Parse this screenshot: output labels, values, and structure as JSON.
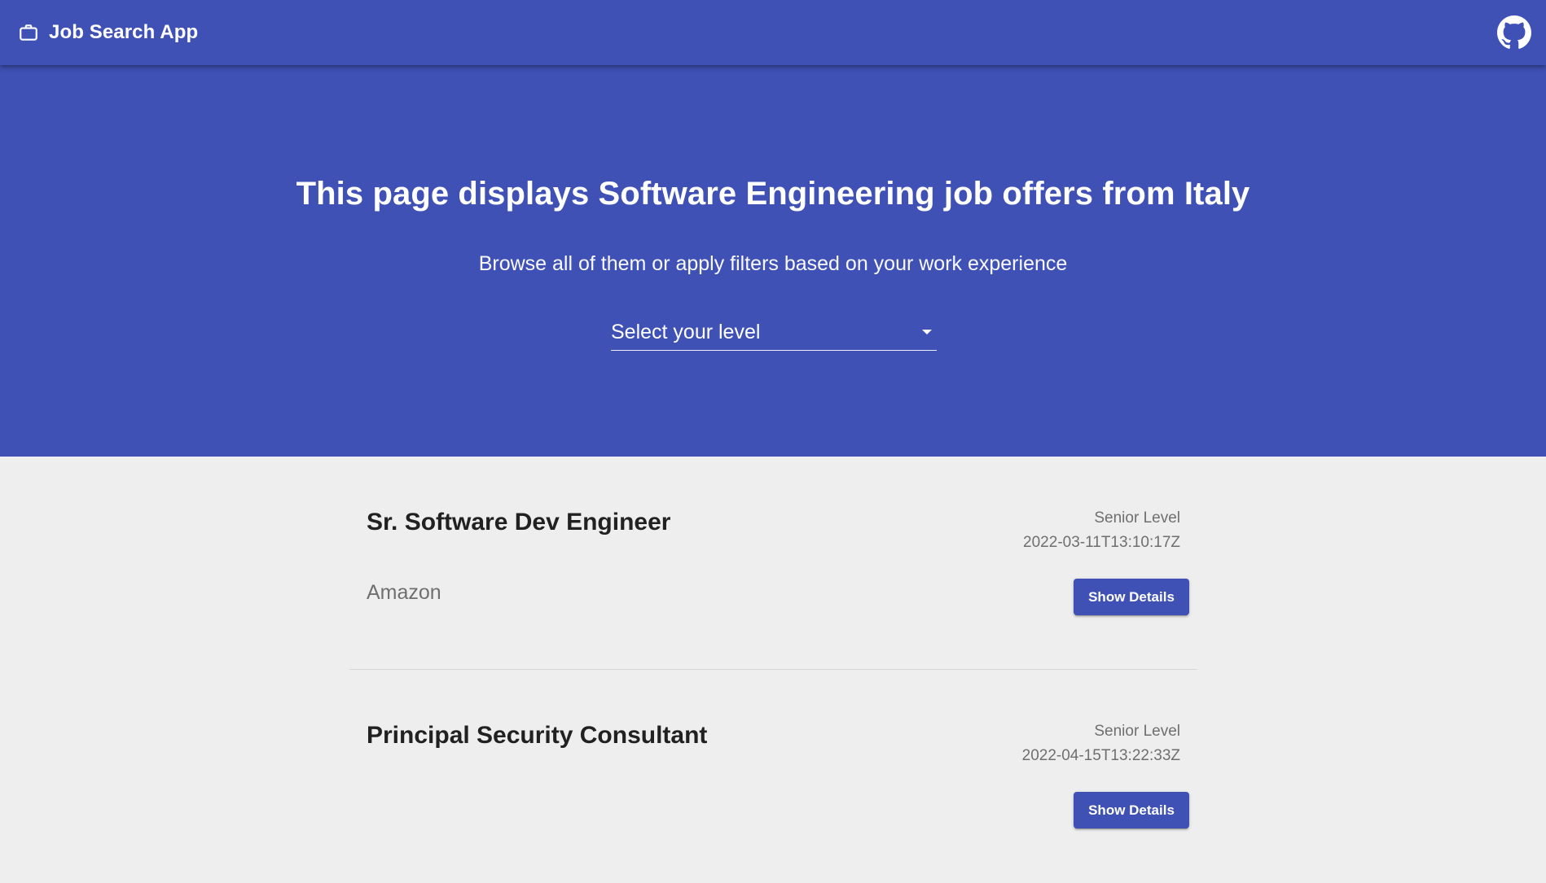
{
  "appbar": {
    "title": "Job Search App",
    "brand_icon": "briefcase-icon",
    "github_icon": "github-icon",
    "color": "#3f51b5"
  },
  "hero": {
    "title": "This page displays Software Engineering job offers from Italy",
    "subtitle": "Browse all of them or apply filters based on your work experience",
    "level_select": {
      "placeholder": "Select your level"
    }
  },
  "jobs": [
    {
      "title": "Sr. Software Dev Engineer",
      "company": "Amazon",
      "level": "Senior Level",
      "date": "2022-03-11T13:10:17Z",
      "button_label": "Show Details"
    },
    {
      "title": "Principal Security Consultant",
      "company": "",
      "level": "Senior Level",
      "date": "2022-04-15T13:22:33Z",
      "button_label": "Show Details"
    }
  ]
}
